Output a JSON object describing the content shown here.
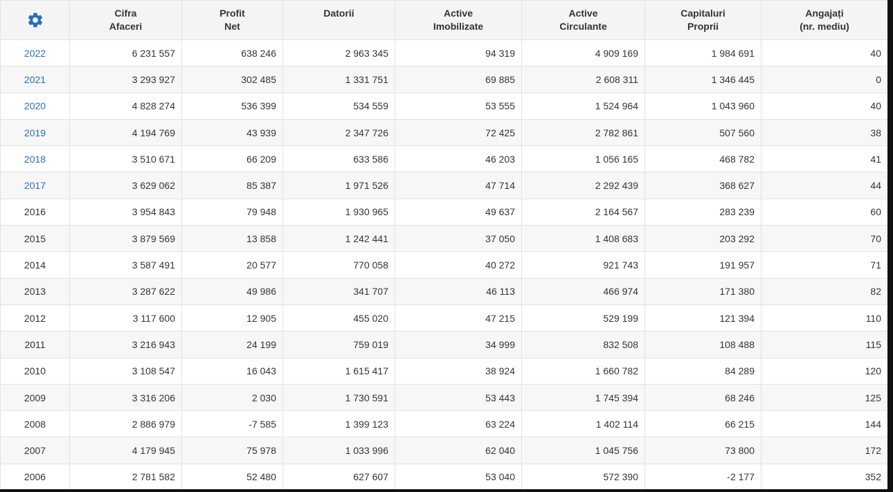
{
  "colors": {
    "accent": "#2a6ebb",
    "header_bg": "#f4f4f4",
    "stripe": "#f7f7f7",
    "border": "#e2e2e2"
  },
  "toolbar": {
    "settings_icon": "gear-icon"
  },
  "columns": [
    {
      "line1": "Cifra",
      "line2": "Afaceri"
    },
    {
      "line1": "Profit",
      "line2": "Net"
    },
    {
      "line1": "Datorii",
      "line2": ""
    },
    {
      "line1": "Active",
      "line2": "Imobilizate"
    },
    {
      "line1": "Active",
      "line2": "Circulante"
    },
    {
      "line1": "Capitaluri",
      "line2": "Proprii"
    },
    {
      "line1": "Angajați",
      "line2": "(nr. mediu)"
    }
  ],
  "rows": [
    {
      "year": "2022",
      "link": true,
      "cells": [
        "6 231 557",
        "638 246",
        "2 963 345",
        "94 319",
        "4 909 169",
        "1 984 691",
        "40"
      ]
    },
    {
      "year": "2021",
      "link": true,
      "cells": [
        "3 293 927",
        "302 485",
        "1 331 751",
        "69 885",
        "2 608 311",
        "1 346 445",
        "0"
      ]
    },
    {
      "year": "2020",
      "link": true,
      "cells": [
        "4 828 274",
        "536 399",
        "534 559",
        "53 555",
        "1 524 964",
        "1 043 960",
        "40"
      ]
    },
    {
      "year": "2019",
      "link": true,
      "cells": [
        "4 194 769",
        "43 939",
        "2 347 726",
        "72 425",
        "2 782 861",
        "507 560",
        "38"
      ]
    },
    {
      "year": "2018",
      "link": true,
      "cells": [
        "3 510 671",
        "66 209",
        "633 586",
        "46 203",
        "1 056 165",
        "468 782",
        "41"
      ]
    },
    {
      "year": "2017",
      "link": true,
      "cells": [
        "3 629 062",
        "85 387",
        "1 971 526",
        "47 714",
        "2 292 439",
        "368 627",
        "44"
      ]
    },
    {
      "year": "2016",
      "link": false,
      "cells": [
        "3 954 843",
        "79 948",
        "1 930 965",
        "49 637",
        "2 164 567",
        "283 239",
        "60"
      ]
    },
    {
      "year": "2015",
      "link": false,
      "cells": [
        "3 879 569",
        "13 858",
        "1 242 441",
        "37 050",
        "1 408 683",
        "203 292",
        "70"
      ]
    },
    {
      "year": "2014",
      "link": false,
      "cells": [
        "3 587 491",
        "20 577",
        "770 058",
        "40 272",
        "921 743",
        "191 957",
        "71"
      ]
    },
    {
      "year": "2013",
      "link": false,
      "cells": [
        "3 287 622",
        "49 986",
        "341 707",
        "46 113",
        "466 974",
        "171 380",
        "82"
      ]
    },
    {
      "year": "2012",
      "link": false,
      "cells": [
        "3 117 600",
        "12 905",
        "455 020",
        "47 215",
        "529 199",
        "121 394",
        "110"
      ]
    },
    {
      "year": "2011",
      "link": false,
      "cells": [
        "3 216 943",
        "24 199",
        "759 019",
        "34 999",
        "832 508",
        "108 488",
        "115"
      ]
    },
    {
      "year": "2010",
      "link": false,
      "cells": [
        "3 108 547",
        "16 043",
        "1 615 417",
        "38 924",
        "1 660 782",
        "84 289",
        "120"
      ]
    },
    {
      "year": "2009",
      "link": false,
      "cells": [
        "3 316 206",
        "2 030",
        "1 730 591",
        "53 443",
        "1 745 394",
        "68 246",
        "125"
      ]
    },
    {
      "year": "2008",
      "link": false,
      "cells": [
        "2 886 979",
        "-7 585",
        "1 399 123",
        "63 224",
        "1 402 114",
        "66 215",
        "144"
      ]
    },
    {
      "year": "2007",
      "link": false,
      "cells": [
        "4 179 945",
        "75 978",
        "1 033 996",
        "62 040",
        "1 045 756",
        "73 800",
        "172"
      ]
    },
    {
      "year": "2006",
      "link": false,
      "cells": [
        "2 781 582",
        "52 480",
        "627 607",
        "53 040",
        "572 390",
        "-2 177",
        "352"
      ]
    }
  ]
}
